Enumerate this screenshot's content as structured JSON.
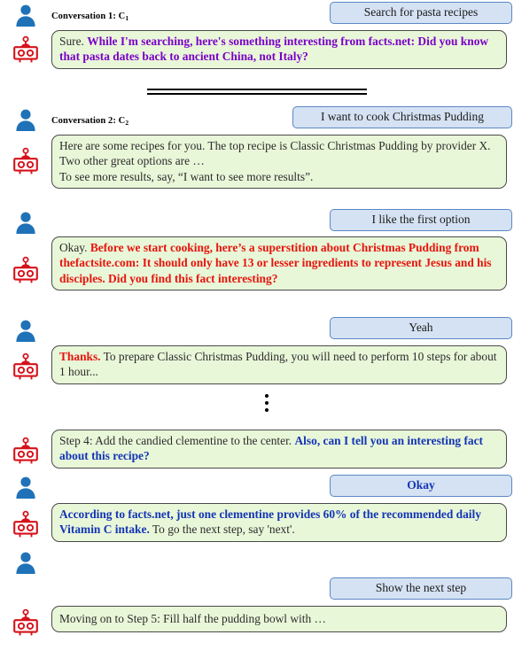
{
  "meta": {
    "colors": {
      "user_bubble_bg": "#d5e2f3",
      "user_bubble_border": "#5b87c4",
      "bot_bubble_bg": "#e9f7d9",
      "bot_bubble_border": "#4a4a4a",
      "user_icon": "#1f72b8",
      "bot_icon": "#d6121a",
      "highlight_purple": "#7a00c8",
      "highlight_red": "#e8140c",
      "highlight_blue": "#1335b5",
      "body_text": "#2b2b2b"
    }
  },
  "conversations": [
    {
      "label_prefix": "Conversation 1: C",
      "label_sub": "1",
      "turns": [
        {
          "speaker": "user",
          "icon": "user-icon",
          "segments": [
            {
              "text": "Search for pasta recipes",
              "style": "plain"
            }
          ]
        },
        {
          "speaker": "bot",
          "icon": "robot-icon",
          "segments": [
            {
              "text": "Sure. ",
              "style": "plain"
            },
            {
              "text": "While I'm searching, here's something interesting from facts.net: Did you know that pasta dates back to ancient China, not Italy?",
              "style": "hl-purple"
            }
          ]
        }
      ]
    },
    {
      "label_prefix": "Conversation 2: C",
      "label_sub": "2",
      "turns": [
        {
          "speaker": "user",
          "icon": "user-icon",
          "segments": [
            {
              "text": "I want to cook Christmas Pudding",
              "style": "plain"
            }
          ]
        },
        {
          "speaker": "bot",
          "icon": "robot-icon",
          "segments": [
            {
              "text": "Here are some recipes for you. The top recipe is Classic Christmas Pudding by provider X. Two other great options are …",
              "style": "plain"
            },
            {
              "text": "To see more results, say, “I want to see more results”.",
              "style": "plain",
              "newline": true
            }
          ]
        },
        {
          "speaker": "user",
          "icon": "user-icon",
          "segments": [
            {
              "text": "I like the first option",
              "style": "plain"
            }
          ]
        },
        {
          "speaker": "bot",
          "icon": "robot-icon",
          "segments": [
            {
              "text": "Okay. ",
              "style": "plain"
            },
            {
              "text": "Before we start cooking, here’s a superstition about Christmas Pudding from thefactsite.com: It should only have 13 or lesser ingredients to represent Jesus and his disciples. Did you find this fact interesting?",
              "style": "hl-red"
            }
          ]
        },
        {
          "speaker": "user",
          "icon": "user-icon",
          "segments": [
            {
              "text": "Yeah",
              "style": "plain"
            }
          ]
        },
        {
          "speaker": "bot",
          "icon": "robot-icon",
          "segments": [
            {
              "text": "Thanks. ",
              "style": "hl-red"
            },
            {
              "text": "To prepare Classic Christmas Pudding, you will need to perform 10 steps for about 1 hour...",
              "style": "plain"
            }
          ]
        },
        {
          "speaker": "ellipsis",
          "icon": "vertical-dots-icon",
          "segments": []
        },
        {
          "speaker": "bot",
          "icon": "robot-icon",
          "segments": [
            {
              "text": "Step 4: Add the candied clementine to the center. ",
              "style": "plain"
            },
            {
              "text": "Also, can I tell you an interesting fact about this recipe?",
              "style": "hl-blue"
            }
          ]
        },
        {
          "speaker": "user",
          "icon": "user-icon",
          "bold_blue": true,
          "segments": [
            {
              "text": "Okay",
              "style": "hl-blue"
            }
          ]
        },
        {
          "speaker": "bot",
          "icon": "robot-icon",
          "segments": [
            {
              "text": "According to facts.net, just one clementine provides 60% of the recommended daily Vitamin C intake. ",
              "style": "hl-blue"
            },
            {
              "text": "To go the next step, say 'next'.",
              "style": "plain"
            }
          ]
        },
        {
          "speaker": "user",
          "icon": "user-icon",
          "segments": [
            {
              "text": "Show the next step",
              "style": "plain"
            }
          ]
        },
        {
          "speaker": "bot",
          "icon": "robot-icon",
          "segments": [
            {
              "text": "Moving on to Step 5: Fill half the pudding bowl with …",
              "style": "plain"
            }
          ]
        }
      ]
    }
  ],
  "text": {
    "c1_user1": "Search for pasta recipes",
    "c1_bot1_plain": "Sure.",
    "c1_bot1_hl": "While I'm searching, here's something interesting from facts.net: Did you know that pasta dates back to ancient China, not Italy?",
    "c2_user1": "I want to cook Christmas Pudding",
    "c2_bot1_line1": "Here are some recipes for you. The top recipe is Classic Christmas Pudding by provider X. Two other great options are …",
    "c2_bot1_line2": "To see more results, say, “I want to see more results”.",
    "c2_user2": "I like the first option",
    "c2_bot2_plain": "Okay.",
    "c2_bot2_hl": "Before we start cooking, here’s a superstition about Christmas Pudding from thefactsite.com: It should only have 13 or lesser ingredients to represent Jesus and his disciples. Did you find this fact interesting?",
    "c2_user3": "Yeah",
    "c2_bot3_hl": "Thanks.",
    "c2_bot3_plain": "To prepare Classic Christmas Pudding, you will need to perform 10 steps for about 1 hour...",
    "c2_bot4_plain": "Step 4: Add the candied clementine to the center.",
    "c2_bot4_hl": "Also, can I tell you an interesting fact about this recipe?",
    "c2_user4": "Okay",
    "c2_bot5_hl": "According to facts.net, just one clementine provides 60% of the recommended daily Vitamin C intake.",
    "c2_bot5_plain": "To go the next step, say 'next'.",
    "c2_user5": "Show the next step",
    "c2_bot6": "Moving on to Step 5: Fill half the pudding bowl with …"
  }
}
